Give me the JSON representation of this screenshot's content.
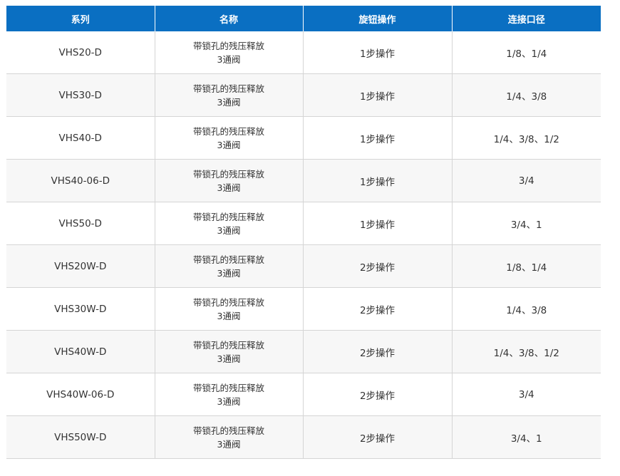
{
  "table": {
    "headers": [
      "系列",
      "名称",
      "旋钮操作",
      "连接口径"
    ],
    "rows": [
      {
        "series": "VHS20-D",
        "name_line1": "带锁孔的残压释放",
        "name_line2": "3通阀",
        "operation": "1步操作",
        "port": "1/8、1/4"
      },
      {
        "series": "VHS30-D",
        "name_line1": "带锁孔的残压释放",
        "name_line2": "3通阀",
        "operation": "1步操作",
        "port": "1/4、3/8"
      },
      {
        "series": "VHS40-D",
        "name_line1": "带锁孔的残压释放",
        "name_line2": "3通阀",
        "operation": "1步操作",
        "port": "1/4、3/8、1/2"
      },
      {
        "series": "VHS40-06-D",
        "name_line1": "带锁孔的残压释放",
        "name_line2": "3通阀",
        "operation": "1步操作",
        "port": "3/4"
      },
      {
        "series": "VHS50-D",
        "name_line1": "带锁孔的残压释放",
        "name_line2": "3通阀",
        "operation": "1步操作",
        "port": "3/4、1"
      },
      {
        "series": "VHS20W-D",
        "name_line1": "带锁孔的残压释放",
        "name_line2": "3通阀",
        "operation": "2步操作",
        "port": "1/8、1/4"
      },
      {
        "series": "VHS30W-D",
        "name_line1": "带锁孔的残压释放",
        "name_line2": "3通阀",
        "operation": "2步操作",
        "port": "1/4、3/8"
      },
      {
        "series": "VHS40W-D",
        "name_line1": "带锁孔的残压释放",
        "name_line2": "3通阀",
        "operation": "2步操作",
        "port": "1/4、3/8、1/2"
      },
      {
        "series": "VHS40W-06-D",
        "name_line1": "带锁孔的残压释放",
        "name_line2": "3通阀",
        "operation": "2步操作",
        "port": "3/4"
      },
      {
        "series": "VHS50W-D",
        "name_line1": "带锁孔的残压释放",
        "name_line2": "3通阀",
        "operation": "2步操作",
        "port": "3/4、1"
      }
    ]
  },
  "colors": {
    "header_bg": "#0a6fc2",
    "header_text": "#ffffff",
    "row_alt_bg": "#f7f7f7",
    "border": "#d5d5d5"
  }
}
